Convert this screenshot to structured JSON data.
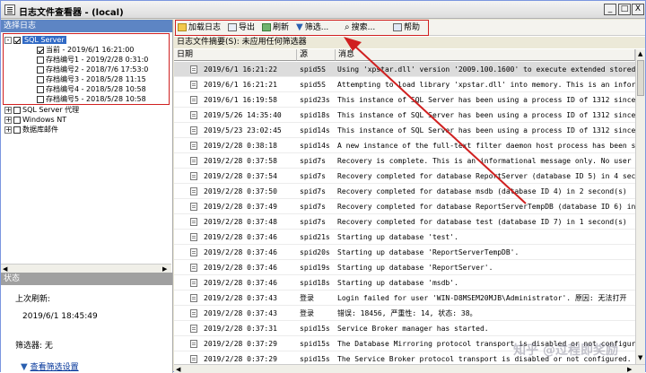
{
  "window": {
    "title": "日志文件查看器 - (local)",
    "min_label": "_",
    "max_label": "□",
    "close_label": "X"
  },
  "left": {
    "header": "选择日志",
    "tree": [
      {
        "label": "SQL Server",
        "expander": "-",
        "checked": true,
        "selected": true
      },
      {
        "label": "当前 - 2019/6/1 16:21:00",
        "checked": true
      },
      {
        "label": "存档编号1 - 2019/2/28 0:31:0",
        "checked": false
      },
      {
        "label": "存档编号2 - 2018/7/6 17:53:0",
        "checked": false
      },
      {
        "label": "存档编号3 - 2018/5/28 11:15",
        "checked": false
      },
      {
        "label": "存档编号4 - 2018/5/28 10:58",
        "checked": false
      },
      {
        "label": "存档编号5 - 2018/5/28 10:58",
        "checked": false
      },
      {
        "label": "SQL Server 代理",
        "expander": "+",
        "checked": false
      },
      {
        "label": "Windows NT",
        "expander": "+",
        "checked": false
      },
      {
        "label": "数据库邮件",
        "expander": "+",
        "checked": false
      }
    ],
    "status": {
      "header": "状态",
      "last_refresh_label": "上次刷新:",
      "last_refresh_value": "2019/6/1 18:45:49",
      "filter_label": "筛选器: 无",
      "view_filter_link": "查看筛选设置"
    }
  },
  "toolbar": {
    "load": "加载日志",
    "export": "导出",
    "refresh": "刷新",
    "filter": "筛选...",
    "search": "搜索...",
    "help": "帮助"
  },
  "summary": "日志文件摘要(S): 未应用任何筛选器",
  "columns": {
    "date": "日期",
    "source": "源",
    "message": "消息"
  },
  "rows": [
    {
      "date": "2019/6/1 16:21:22",
      "source": "spid5S",
      "message": "Using 'xpstar.dll' version '2009.100.1600' to execute extended stored"
    },
    {
      "date": "2019/6/1 16:21:21",
      "source": "spid5S",
      "message": "Attempting to load library 'xpstar.dll' into memory. This is an infor"
    },
    {
      "date": "2019/6/1 16:19:58",
      "source": "spid23s",
      "message": "This instance of SQL Server has been using a process ID of 1312 since"
    },
    {
      "date": "2019/5/26 14:35:40",
      "source": "spid18s",
      "message": "This instance of SQL Server has been using a process ID of 1312 since"
    },
    {
      "date": "2019/5/23 23:02:45",
      "source": "spid14s",
      "message": "This instance of SQL Server has been using a process ID of 1312 since"
    },
    {
      "date": "2019/2/28 0:38:18",
      "source": "spid14s",
      "message": "A new instance of the full-text filter daemon host process has been s"
    },
    {
      "date": "2019/2/28 0:37:58",
      "source": "spid7s",
      "message": "Recovery is complete. This is an informational message only. No user"
    },
    {
      "date": "2019/2/28 0:37:54",
      "source": "spid7s",
      "message": "Recovery completed for database ReportServer (database ID 5) in 4 sec"
    },
    {
      "date": "2019/2/28 0:37:50",
      "source": "spid7s",
      "message": "Recovery completed for database msdb (database ID 4) in 2 second(s)"
    },
    {
      "date": "2019/2/28 0:37:49",
      "source": "spid7s",
      "message": "Recovery completed for database ReportServerTempDB (database ID 6) in"
    },
    {
      "date": "2019/2/28 0:37:48",
      "source": "spid7s",
      "message": "Recovery completed for database test (database ID 7) in 1 second(s)"
    },
    {
      "date": "2019/2/28 0:37:46",
      "source": "spid21s",
      "message": "Starting up database 'test'."
    },
    {
      "date": "2019/2/28 0:37:46",
      "source": "spid20s",
      "message": "Starting up database 'ReportServerTempDB'."
    },
    {
      "date": "2019/2/28 0:37:46",
      "source": "spid19s",
      "message": "Starting up database 'ReportServer'."
    },
    {
      "date": "2019/2/28 0:37:46",
      "source": "spid18s",
      "message": "Starting up database 'msdb'."
    },
    {
      "date": "2019/2/28 0:37:43",
      "source": "登录",
      "message": "Login failed for user 'WIN-D8MSEM20MJB\\Administrator'. 原因: 无法打开"
    },
    {
      "date": "2019/2/28 0:37:43",
      "source": "登录",
      "message": "错误: 18456, 严重性: 14, 状态: 38。"
    },
    {
      "date": "2019/2/28 0:37:31",
      "source": "spid15s",
      "message": "Service Broker manager has started."
    },
    {
      "date": "2019/2/28 0:37:29",
      "source": "spid15s",
      "message": "The Database Mirroring protocol transport is disabled or not configur"
    },
    {
      "date": "2019/2/28 0:37:29",
      "source": "spid15s",
      "message": "The Service Broker protocol transport is disabled or not configured."
    }
  ],
  "watermark": "知乎 @过程即奖励",
  "colors": {
    "accent": "#316ac5",
    "highlight": "#d02020",
    "header": "#5d85c4"
  }
}
